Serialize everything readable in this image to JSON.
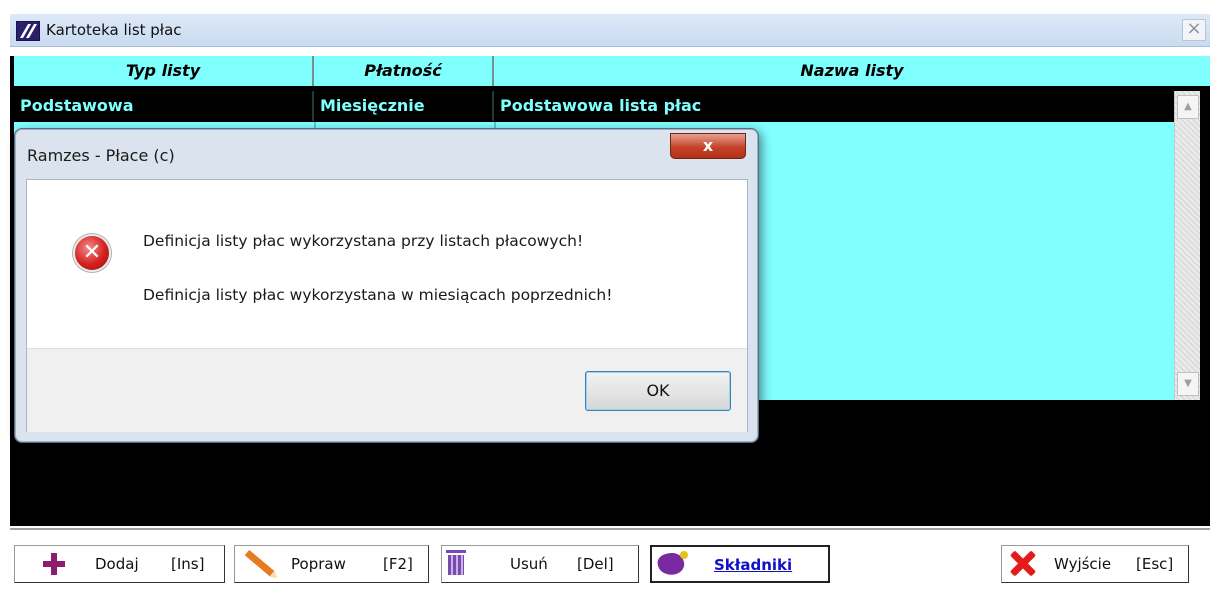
{
  "window": {
    "title": "Kartoteka list płac",
    "close_glyph": "×"
  },
  "grid": {
    "columns": [
      "Typ listy",
      "Płatność",
      "Nazwa listy"
    ],
    "selected_row": {
      "typ": "Podstawowa",
      "platnosc": "Miesięcznie",
      "nazwa": "Podstawowa lista płac"
    },
    "colors": {
      "header_bg": "#80ffff",
      "selected_bg": "#000000",
      "selected_text": "#80ffff"
    }
  },
  "dialog": {
    "title": "Ramzes - Płace (c)",
    "close_glyph": "x",
    "message_1": "Definicja listy płac wykorzystana przy listach płacowych!",
    "message_2": "Definicja listy płac wykorzystana w miesiącach poprzednich!",
    "ok_label": "OK",
    "icon": "error-icon"
  },
  "toolbar": {
    "add": {
      "label": "Dodaj",
      "key": "[Ins]",
      "icon": "plus-icon"
    },
    "edit": {
      "label": "Popraw",
      "key": "[F2]",
      "icon": "pencil-icon"
    },
    "delete": {
      "label": "Usuń",
      "key": "[Del]",
      "icon": "trash-icon"
    },
    "components": {
      "label": "Składniki",
      "icon": "components-icon"
    },
    "exit": {
      "label": "Wyjście",
      "key": "[Esc]",
      "icon": "red-x-icon"
    }
  }
}
